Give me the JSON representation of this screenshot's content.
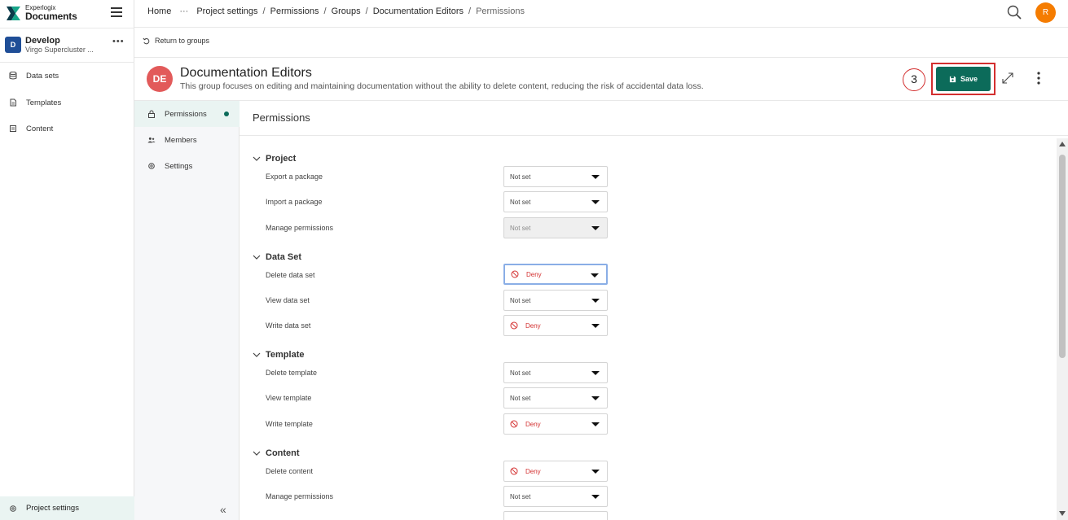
{
  "brand": {
    "top": "Experlogix",
    "bottom": "Documents",
    "colors": {
      "primary": "#0c6b5a",
      "dark": "#0b3b4a"
    }
  },
  "project": {
    "badge": "D",
    "name": "Develop",
    "subtitle": "Virgo Supercluster ...",
    "badge_color": "#1f4e97"
  },
  "leftnav": {
    "items": [
      {
        "label": "Data sets",
        "icon": "database-icon"
      },
      {
        "label": "Templates",
        "icon": "document-icon"
      },
      {
        "label": "Content",
        "icon": "content-icon"
      }
    ],
    "bottom": {
      "label": "Project settings",
      "icon": "gear-icon"
    }
  },
  "breadcrumb": {
    "home": "Home",
    "ellipsis": "···",
    "items": [
      "Project settings",
      "Permissions",
      "Groups",
      "Documentation Editors"
    ],
    "current": "Permissions",
    "separator": "/"
  },
  "user": {
    "initial": "R",
    "color": "#f57c00"
  },
  "return_link": "Return to groups",
  "group": {
    "initials": "DE",
    "title": "Documentation Editors",
    "description": "This group focuses on editing and maintaining documentation without the ability to delete content, reducing the risk of accidental data loss.",
    "badge_color": "#e25a5a"
  },
  "annotation": {
    "step": "3",
    "color": "#d32f2f"
  },
  "actions": {
    "save_label": "Save"
  },
  "sidenav": {
    "items": [
      {
        "label": "Permissions",
        "icon": "lock-icon",
        "active": true,
        "has_dot": true
      },
      {
        "label": "Members",
        "icon": "members-icon"
      },
      {
        "label": "Settings",
        "icon": "settings-icon"
      }
    ],
    "collapse": "«"
  },
  "permissions": {
    "title": "Permissions",
    "sections": [
      {
        "name": "Project",
        "rows": [
          {
            "label": "Export a package",
            "value": "Not set"
          },
          {
            "label": "Import a package",
            "value": "Not set"
          },
          {
            "label": "Manage permissions",
            "value": "Not set",
            "disabled": true
          }
        ]
      },
      {
        "name": "Data Set",
        "rows": [
          {
            "label": "Delete data set",
            "value": "Deny",
            "deny": true,
            "focused": true
          },
          {
            "label": "View data set",
            "value": "Not set"
          },
          {
            "label": "Write data set",
            "value": "Deny",
            "deny": true
          }
        ]
      },
      {
        "name": "Template",
        "rows": [
          {
            "label": "Delete template",
            "value": "Not set"
          },
          {
            "label": "View template",
            "value": "Not set"
          },
          {
            "label": "Write template",
            "value": "Deny",
            "deny": true
          }
        ]
      },
      {
        "name": "Content",
        "rows": [
          {
            "label": "Delete content",
            "value": "Deny",
            "deny": true
          },
          {
            "label": "Manage permissions",
            "value": "Not set"
          }
        ]
      }
    ]
  }
}
